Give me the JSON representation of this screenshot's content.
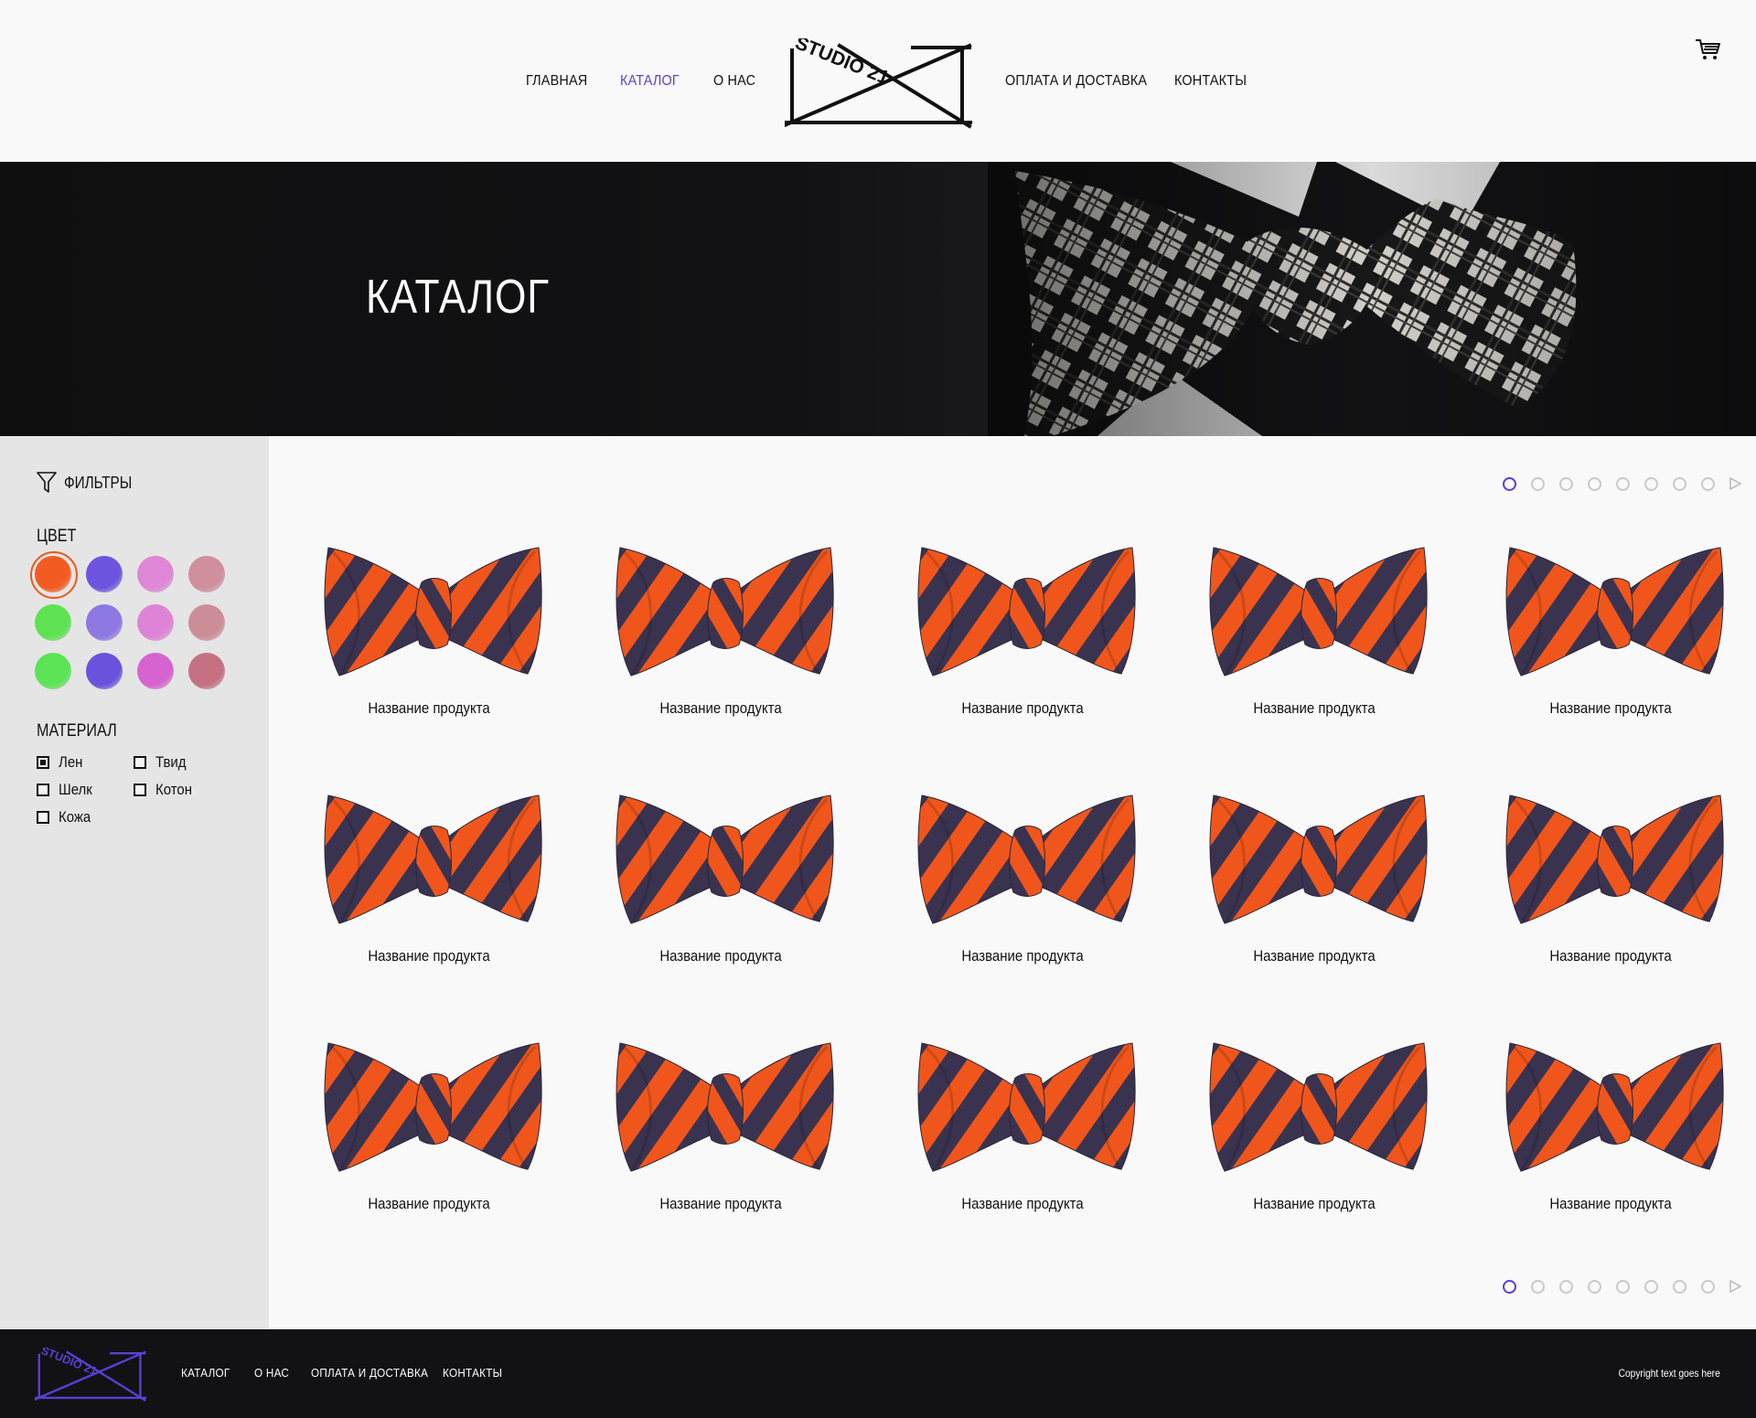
{
  "brand": {
    "logo_text": "STUDIO 21"
  },
  "nav": {
    "left": [
      {
        "label": "ГЛАВНАЯ"
      },
      {
        "label": "КАТАЛОГ"
      },
      {
        "label": "О НАС"
      }
    ],
    "right": [
      {
        "label": "ОПЛАТА И ДОСТАВКА"
      },
      {
        "label": "КОНТАКТЫ"
      }
    ],
    "active": "КАТАЛОГ",
    "accent_color": "#5b3fd6"
  },
  "cart": {
    "icon": "cart-icon"
  },
  "hero": {
    "title": "КАТАЛОГ"
  },
  "sidebar": {
    "filters_label": "ФИЛЬТРЫ",
    "filters_icon": "funnel-icon",
    "color_title": "ЦВЕТ",
    "colors": [
      "#f25c22",
      "#6d55e0",
      "#de87d6",
      "#cf8f9b",
      "#5fe252",
      "#8e78e2",
      "#de84d6",
      "#cc8e96",
      "#5ce356",
      "#6a52dd",
      "#d663cf",
      "#c57181"
    ],
    "selected_color_index": 0,
    "material_title": "МАТЕРИАЛ",
    "materials": [
      {
        "label": "Лен",
        "checked": true
      },
      {
        "label": "Твид",
        "checked": false
      },
      {
        "label": "Шелк",
        "checked": false
      },
      {
        "label": "Котон",
        "checked": false
      },
      {
        "label": "Кожа",
        "checked": false
      }
    ]
  },
  "pagination": {
    "pages": 8,
    "current": 1
  },
  "products": [
    {
      "name": "Название продукта"
    },
    {
      "name": "Название продукта"
    },
    {
      "name": "Название продукта"
    },
    {
      "name": "Название продукта"
    },
    {
      "name": "Название продукта"
    },
    {
      "name": "Название продукта"
    },
    {
      "name": "Название продукта"
    },
    {
      "name": "Название продукта"
    },
    {
      "name": "Название продукта"
    },
    {
      "name": "Название продукта"
    },
    {
      "name": "Название продукта"
    },
    {
      "name": "Название продукта"
    },
    {
      "name": "Название продукта"
    },
    {
      "name": "Название продукта"
    },
    {
      "name": "Название продукта"
    }
  ],
  "footer": {
    "links": [
      {
        "label": "КАТАЛОГ"
      },
      {
        "label": "О НАС"
      },
      {
        "label": "ОПЛАТА И ДОСТАВКА"
      },
      {
        "label": "КОНТАКТЫ"
      }
    ],
    "copyright": "Copyright text goes here",
    "logo_color": "#5b3fd6"
  }
}
